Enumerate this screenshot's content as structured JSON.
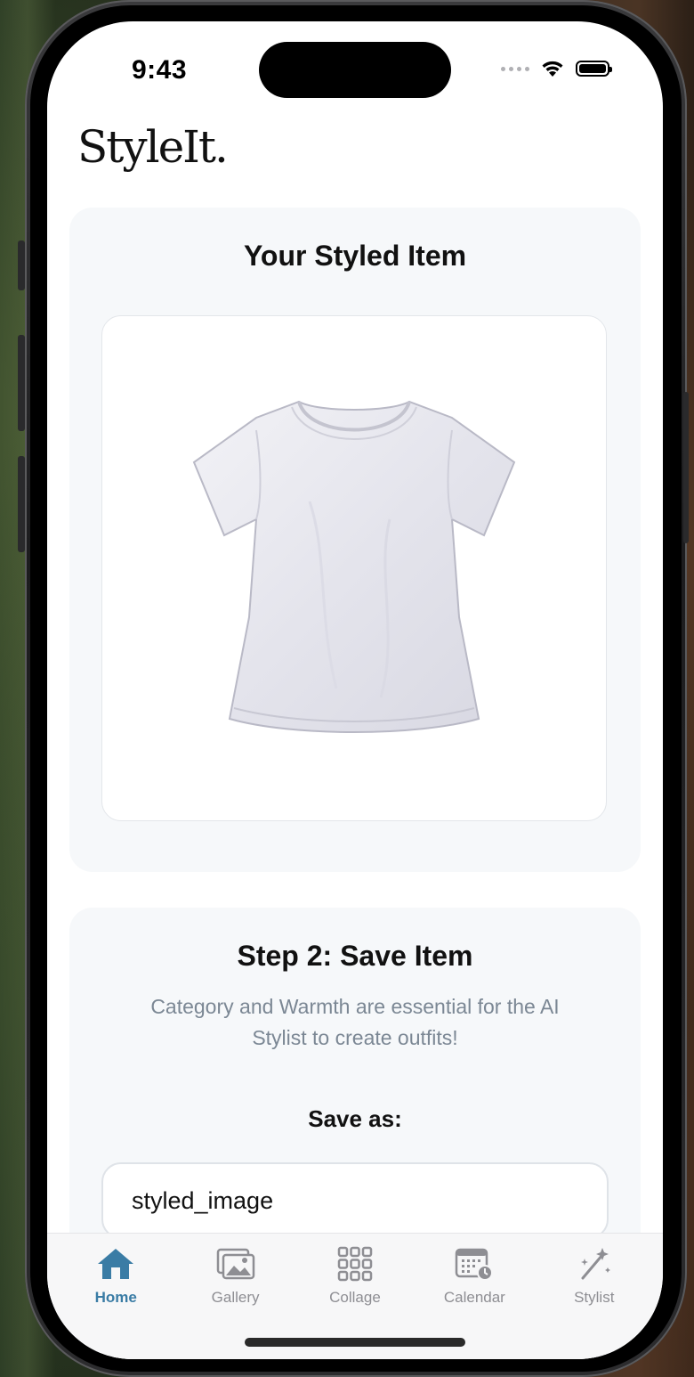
{
  "status_bar": {
    "time": "9:43"
  },
  "app": {
    "logo": "StyleIt."
  },
  "styled_card": {
    "title": "Your Styled Item",
    "image_description_icon": "tshirt-icon"
  },
  "save_card": {
    "title": "Step 2: Save Item",
    "subtitle": "Category and Warmth are essential for the AI Stylist to create outfits!",
    "save_as_label": "Save as:",
    "name_input_value": "styled_image"
  },
  "tabs": [
    {
      "label": "Home",
      "icon": "home-icon",
      "active": true
    },
    {
      "label": "Gallery",
      "icon": "gallery-icon",
      "active": false
    },
    {
      "label": "Collage",
      "icon": "grid-icon",
      "active": false
    },
    {
      "label": "Calendar",
      "icon": "calendar-icon",
      "active": false
    },
    {
      "label": "Stylist",
      "icon": "magic-wand-icon",
      "active": false
    }
  ],
  "colors": {
    "accent": "#3a7ca5",
    "card_bg": "#f6f8fa",
    "muted_text": "#7b8794"
  }
}
